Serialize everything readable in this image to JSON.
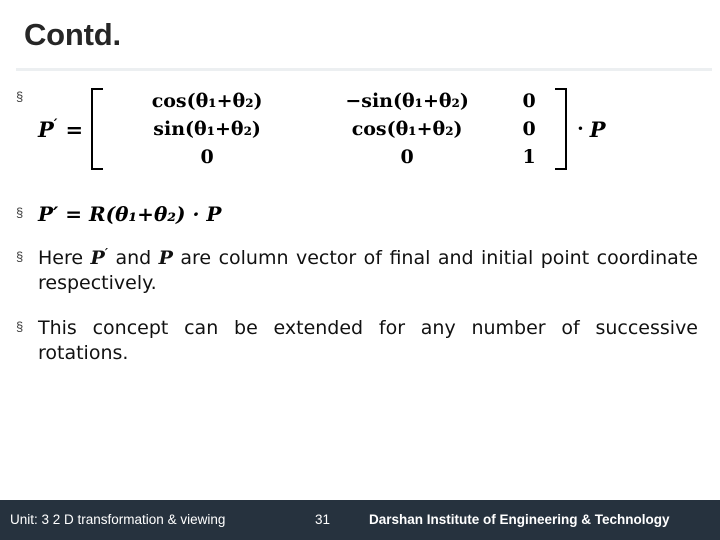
{
  "slide": {
    "title": "Contd.",
    "bullet_marker": "§"
  },
  "equations": {
    "eq1": {
      "lhs": "P",
      "prime": "′",
      "equals": "=",
      "matrix": [
        [
          "cos(θ₁+θ₂)",
          "−sin(θ₁+θ₂)",
          "0"
        ],
        [
          "sin(θ₁+θ₂)",
          "cos(θ₁+θ₂)",
          "0"
        ],
        [
          "0",
          "0",
          "1"
        ]
      ],
      "operator": "·",
      "rhs": "P"
    },
    "eq2": {
      "text": "P′ = R(θ₁+θ₂) · P"
    }
  },
  "paragraphs": {
    "p1_part1": "Here",
    "p1_pprime": "P",
    "p1_prime": "′",
    "p1_part2": "and",
    "p1_p": "P",
    "p1_part3": "are column vector of final and initial point coordinate respectively.",
    "p2": "This concept can be extended for any number of successive rotations."
  },
  "footer": {
    "unit": "Unit: 3 2 D transformation & viewing",
    "page": "31",
    "organization": "Darshan Institute of Engineering & Technology",
    "background_color": "#26323e"
  }
}
